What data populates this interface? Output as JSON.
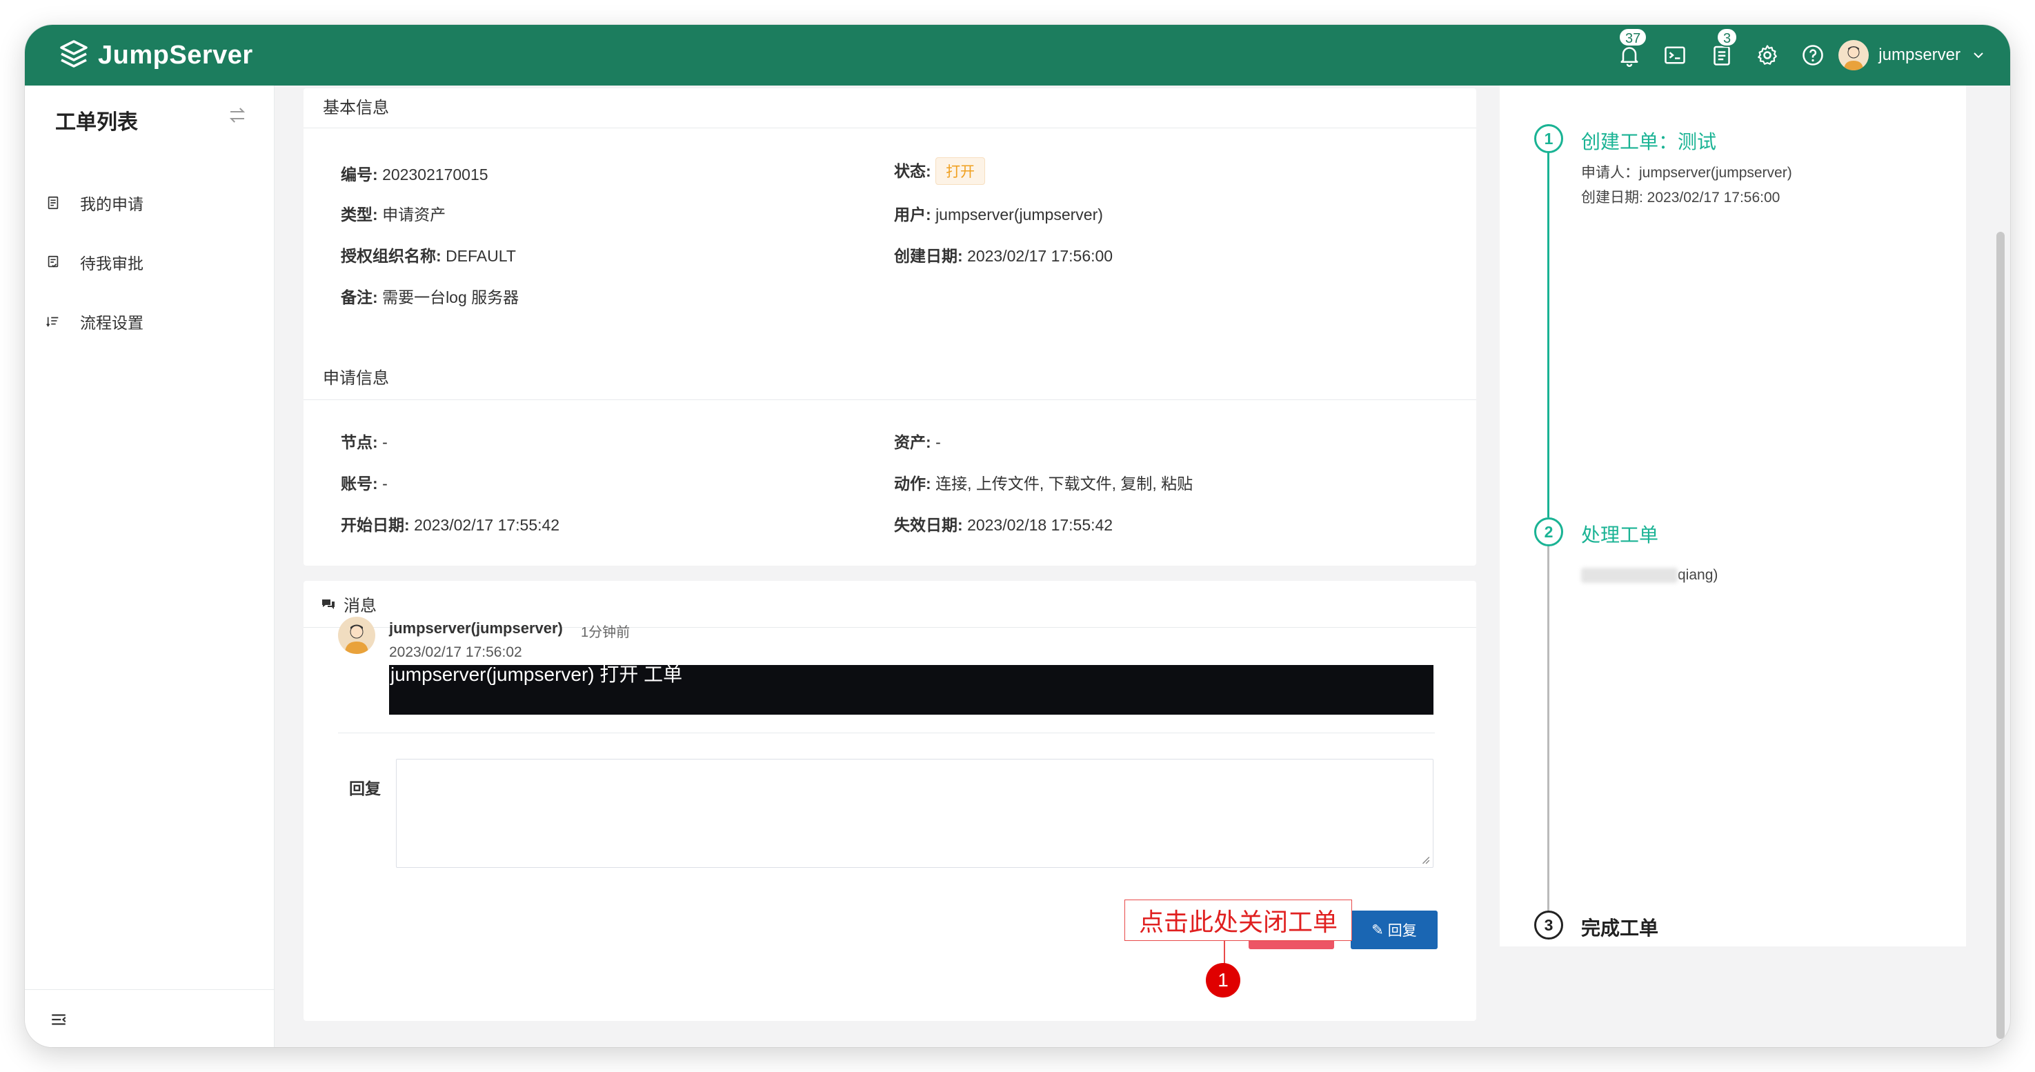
{
  "brand": {
    "name": "JumpServer"
  },
  "topbar": {
    "notification_badge": "37",
    "tickets_badge": "3",
    "username": "jumpserver"
  },
  "sidebar": {
    "title": "工单列表",
    "items": [
      {
        "label": "我的申请"
      },
      {
        "label": "待我审批"
      },
      {
        "label": "流程设置"
      }
    ]
  },
  "basic_info": {
    "heading": "基本信息",
    "number_label": "编号:",
    "number": "202302170015",
    "status_label": "状态:",
    "status": "打开",
    "type_label": "类型:",
    "type": "申请资产",
    "user_label": "用户:",
    "user": "jumpserver(jumpserver)",
    "org_label": "授权组织名称:",
    "org": "DEFAULT",
    "created_label": "创建日期:",
    "created": "2023/02/17 17:56:00",
    "remark_label": "备注:",
    "remark": "需要一台log 服务器"
  },
  "apply_info": {
    "heading": "申请信息",
    "node_label": "节点:",
    "node": "-",
    "asset_label": "资产:",
    "asset": "-",
    "account_label": "账号:",
    "account": "-",
    "action_label": "动作:",
    "action": "连接, 上传文件, 下载文件, 复制, 粘贴",
    "start_label": "开始日期:",
    "start": "2023/02/17 17:55:42",
    "expire_label": "失效日期:",
    "expire": "2023/02/18 17:55:42"
  },
  "messages": {
    "heading": "消息",
    "author": "jumpserver(jumpserver)",
    "ago": "1分钟前",
    "time": "2023/02/17 17:56:02",
    "body": "jumpserver(jumpserver) 打开 工单",
    "reply_label": "回复",
    "close_button": "关闭",
    "reply_button": "回复"
  },
  "annotation": {
    "callout": "点击此处关闭工单",
    "marker": "1"
  },
  "timeline": {
    "steps": [
      {
        "num": "1",
        "title": "创建工单：测试",
        "lines": [
          "申请人：jumpserver(jumpserver)",
          "创建日期: 2023/02/17 17:56:00"
        ]
      },
      {
        "num": "2",
        "title": "处理工单",
        "lines": [
          "qiang)"
        ]
      },
      {
        "num": "3",
        "title": "完成工单",
        "lines": []
      }
    ]
  },
  "colors": {
    "brand": "#1c7d5e",
    "timeline_active": "#1ab394",
    "close_button": "#ed5565",
    "reply_button": "#1a66b3",
    "status_tag": "#f0a020",
    "annotation": "#e02020"
  }
}
